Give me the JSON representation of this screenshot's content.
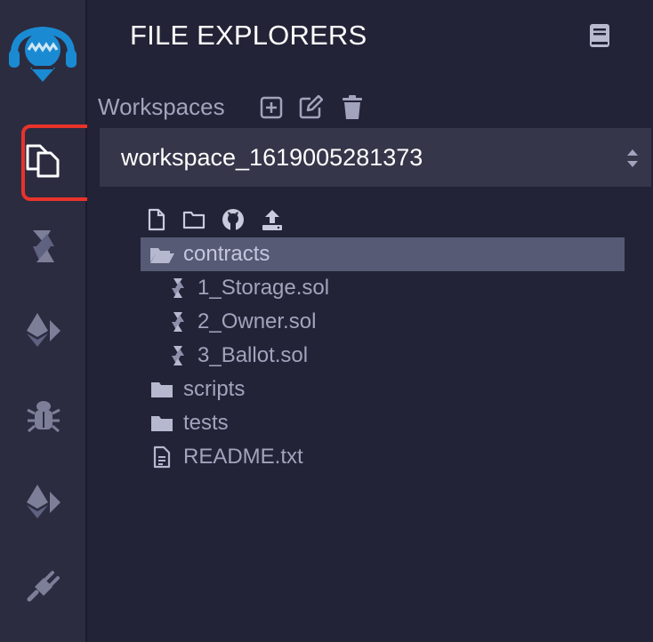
{
  "panel": {
    "title": "FILE EXPLORERS"
  },
  "workspaces": {
    "label": "Workspaces",
    "selected": "workspace_1619005281373"
  },
  "tree": {
    "folder_contracts": "contracts",
    "file_1": "1_Storage.sol",
    "file_2": "2_Owner.sol",
    "file_3": "3_Ballot.sol",
    "folder_scripts": "scripts",
    "folder_tests": "tests",
    "file_readme": "README.txt"
  },
  "colors": {
    "accent": "#1a8bd3",
    "highlight": "#e8332b",
    "text": "#a2a3bd",
    "selected_row": "#565a75"
  },
  "icons": {
    "rail": [
      "remix-logo-icon",
      "file-explorer-icon",
      "solidity-compiler-icon",
      "deploy-run-icon",
      "debugger-icon",
      "ethereum-icon",
      "plugin-manager-icon"
    ],
    "workspace_actions": [
      "plus-square-icon",
      "edit-icon",
      "trash-icon"
    ],
    "explorer_actions": [
      "new-file-icon",
      "new-folder-icon",
      "github-icon",
      "upload-icon"
    ]
  }
}
